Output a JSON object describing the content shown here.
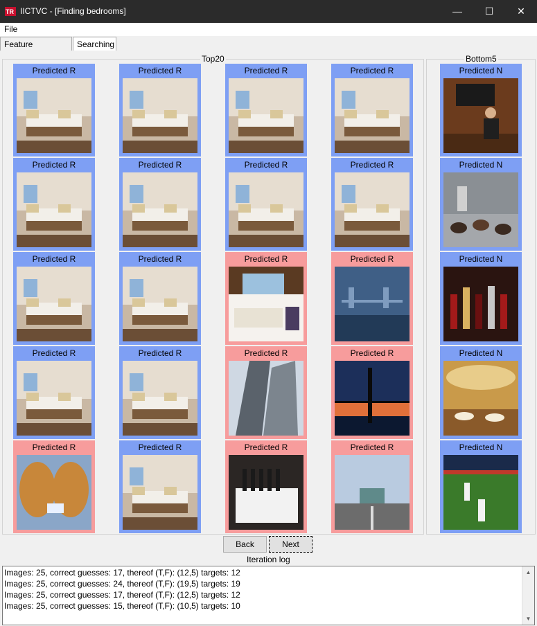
{
  "window": {
    "title": "IICTVC - [Finding bedrooms]",
    "minimize_glyph": "—",
    "maximize_glyph": "☐",
    "close_glyph": "✕"
  },
  "menu": {
    "file": "File"
  },
  "tabs": [
    {
      "label": "Feature extraction"
    },
    {
      "label": "Searching",
      "active": true
    }
  ],
  "top_group": {
    "legend": "Top20",
    "cells": [
      {
        "label": "Predicted R",
        "status": "blue",
        "scene": "bedroom"
      },
      {
        "label": "Predicted R",
        "status": "blue",
        "scene": "bedroom"
      },
      {
        "label": "Predicted R",
        "status": "blue",
        "scene": "bedroom"
      },
      {
        "label": "Predicted R",
        "status": "blue",
        "scene": "bedroom"
      },
      {
        "label": "Predicted R",
        "status": "blue",
        "scene": "bedroom"
      },
      {
        "label": "Predicted R",
        "status": "blue",
        "scene": "bedroom"
      },
      {
        "label": "Predicted R",
        "status": "blue",
        "scene": "bedroom"
      },
      {
        "label": "Predicted R",
        "status": "blue",
        "scene": "bedroom"
      },
      {
        "label": "Predicted R",
        "status": "blue",
        "scene": "bedroom"
      },
      {
        "label": "Predicted R",
        "status": "blue",
        "scene": "bedroom"
      },
      {
        "label": "Predicted R",
        "status": "red",
        "scene": "living-room"
      },
      {
        "label": "Predicted R",
        "status": "red",
        "scene": "bridge-night"
      },
      {
        "label": "Predicted R",
        "status": "blue",
        "scene": "bedroom"
      },
      {
        "label": "Predicted R",
        "status": "blue",
        "scene": "bedroom"
      },
      {
        "label": "Predicted R",
        "status": "red",
        "scene": "skyscraper"
      },
      {
        "label": "Predicted R",
        "status": "red",
        "scene": "bridge-sunset"
      },
      {
        "label": "Predicted R",
        "status": "red",
        "scene": "bread"
      },
      {
        "label": "Predicted R",
        "status": "blue",
        "scene": "bedroom"
      },
      {
        "label": "Predicted R",
        "status": "red",
        "scene": "wine-table"
      },
      {
        "label": "Predicted R",
        "status": "red",
        "scene": "highway"
      }
    ]
  },
  "bottom_group": {
    "legend": "Bottom5",
    "cells": [
      {
        "label": "Predicted N",
        "status": "blue",
        "scene": "bar-man"
      },
      {
        "label": "Predicted N",
        "status": "blue",
        "scene": "dogs"
      },
      {
        "label": "Predicted N",
        "status": "blue",
        "scene": "bottles"
      },
      {
        "label": "Predicted N",
        "status": "blue",
        "scene": "banquet-hall"
      },
      {
        "label": "Predicted N",
        "status": "blue",
        "scene": "baseball"
      }
    ]
  },
  "buttons": {
    "back": "Back",
    "next": "Next"
  },
  "log": {
    "legend": "Iteration log",
    "lines": [
      "Images: 25, correct guesses: 17, thereof (T,F): (12,5) targets: 12",
      "Images: 25, correct guesses: 24, thereof (T,F): (19,5) targets: 19",
      "Images: 25, correct guesses: 17, thereof (T,F): (12,5) targets: 12",
      "Images: 25, correct guesses: 15, thereof (T,F): (10,5) targets: 10"
    ]
  },
  "colors": {
    "correct": "#7e9ff4",
    "incorrect": "#f79c9c",
    "titlebar": "#2b2b2b"
  }
}
